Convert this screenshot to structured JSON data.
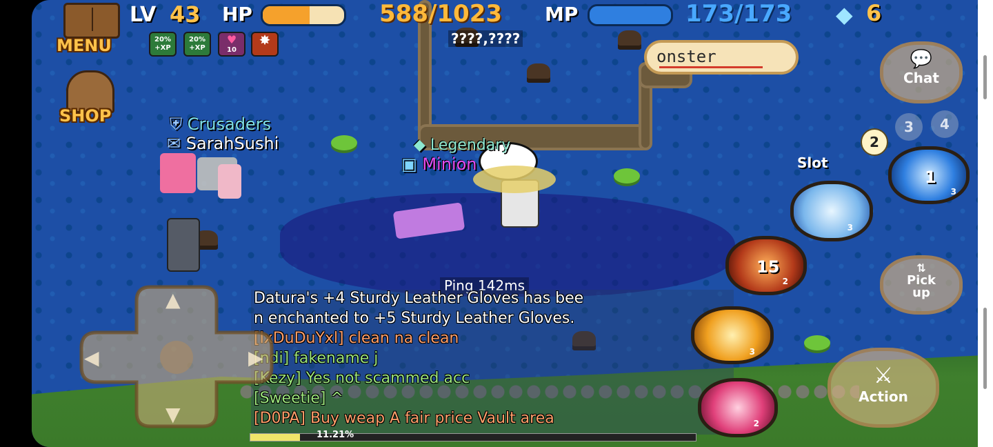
{
  "hud": {
    "menu_label": "MENU",
    "shop_label": "SHOP",
    "lv_label": "LV",
    "level": "43",
    "hp_label": "HP",
    "hp_value": "588/1023",
    "hp_fraction": 0.575,
    "mp_label": "MP",
    "mp_value": "173/173",
    "mp_fraction": 1.0,
    "gems": "6",
    "coords": "????,????",
    "ping": "Ping 142ms",
    "exp_percent": "11.21%",
    "exp_fraction": 0.112
  },
  "buffs": [
    {
      "line1": "20%",
      "line2": "+XP",
      "icon": "xp-boost-icon"
    },
    {
      "line1": "20%",
      "line2": "+XP",
      "icon": "xp-boost-icon"
    },
    {
      "line1": "10",
      "line2": "",
      "icon": "heart-buff-icon"
    },
    {
      "line1": "",
      "line2": "",
      "icon": "rage-buff-icon"
    }
  ],
  "search": {
    "value": "onster"
  },
  "players": {
    "guild_name": "Crusaders",
    "player1": "SarahSushi",
    "player2_tag": "Legendary",
    "player2_name": "Minion"
  },
  "buttons": {
    "chat": "Chat",
    "pickup_line1": "Pick",
    "pickup_line2": "up",
    "action": "Action",
    "slot": "Slot"
  },
  "slots": [
    "2",
    "3",
    "4"
  ],
  "skills": [
    {
      "name": "eye-skill",
      "counter": "1",
      "badge": "3"
    },
    {
      "name": "ice-skill",
      "counter": "",
      "badge": "3"
    },
    {
      "name": "fire-skill",
      "counter": "15",
      "badge": "2"
    },
    {
      "name": "slash-skill",
      "counter": "",
      "badge": "3"
    },
    {
      "name": "spear-skill",
      "counter": "",
      "badge": "2"
    }
  ],
  "chat": [
    {
      "text": "Datura's +4 Sturdy Leather Gloves has bee",
      "color": "#ffffff"
    },
    {
      "text": "n enchanted to +5 Sturdy Leather Gloves.",
      "color": "#ffffff"
    },
    {
      "text": "[lxDuDuYxl] clean na clean",
      "color": "#ff9f6a"
    },
    {
      "text": "[ndi] fakename j",
      "color": "#9be37b"
    },
    {
      "text": "[Kezy] Yes not scammed acc",
      "color": "#9be37b"
    },
    {
      "text": "[Sweetie] ^",
      "color": "#9be37b"
    },
    {
      "text": "[D0PA] Buy weap A fair price Vault area",
      "color": "#ff9f6a"
    }
  ],
  "colors": {
    "water": "#1d4fa6",
    "hp_fill": "#f5a12c",
    "mp_fill": "#2f7fe0",
    "hud_text": "#ffb93b",
    "mp_text": "#49a8ff"
  }
}
